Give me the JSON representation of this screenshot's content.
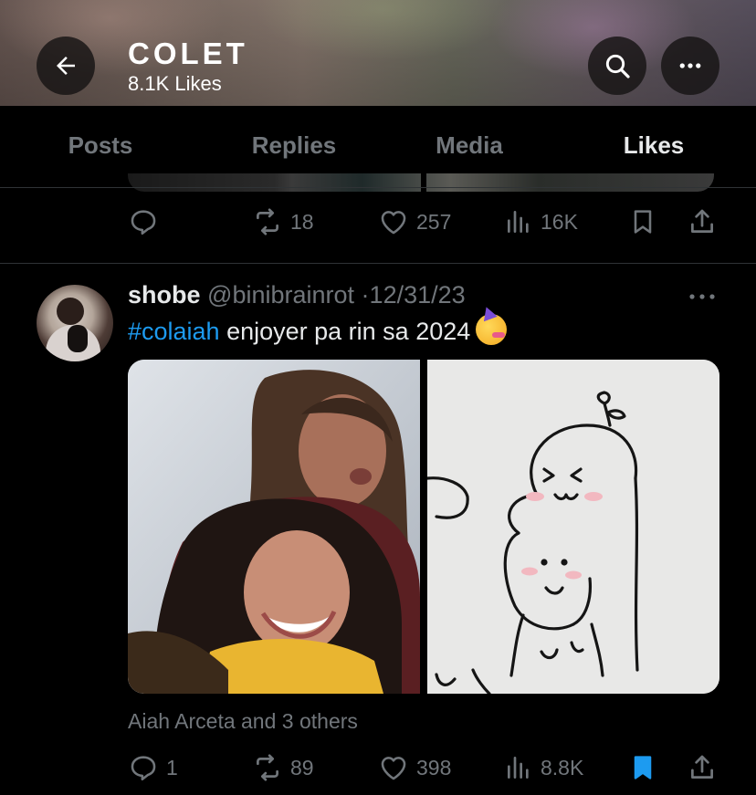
{
  "header": {
    "title": "COLET",
    "subtitle": "8.1K Likes"
  },
  "tabs": [
    {
      "label": "Posts"
    },
    {
      "label": "Replies"
    },
    {
      "label": "Media"
    },
    {
      "label": "Likes"
    }
  ],
  "active_tab": "Likes",
  "prev_tweet": {
    "reposts": "18",
    "likes": "257",
    "views": "16K"
  },
  "tweet": {
    "display_name": "shobe",
    "handle": "@binibrainrot",
    "separator": "·",
    "date": "12/31/23",
    "hashtag": "#colaiah",
    "text": " enjoyer pa rin sa 2024",
    "liked_by": "Aiah Arceta and 3 others",
    "replies": "1",
    "reposts": "89",
    "likes": "398",
    "views": "8.8K",
    "bookmarked": true
  },
  "colors": {
    "accent": "#1d9bf0",
    "background": "#000000",
    "muted": "#71767b"
  },
  "icons": [
    "back-arrow-icon",
    "search-icon",
    "more-icon",
    "reply-icon",
    "repost-icon",
    "like-icon",
    "views-icon",
    "bookmark-icon",
    "share-icon"
  ]
}
